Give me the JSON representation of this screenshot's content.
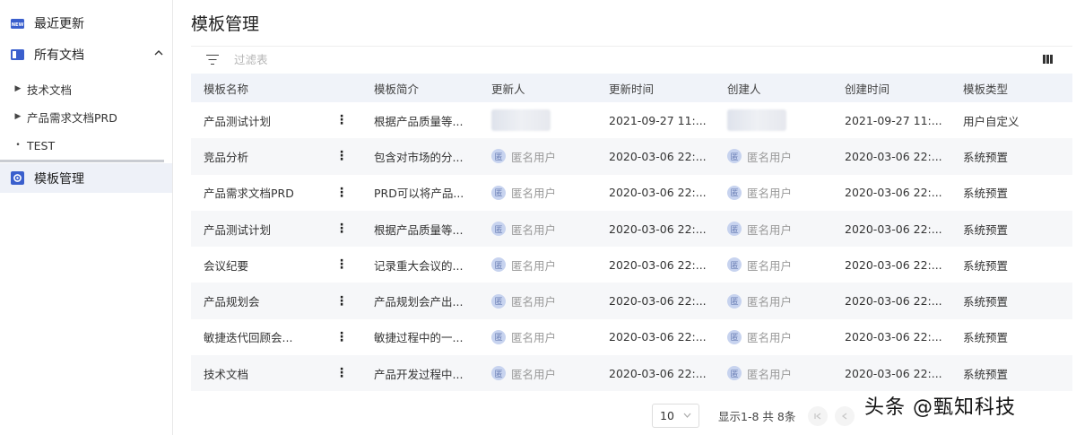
{
  "sidebar": {
    "recent": "最近更新",
    "all_docs": "所有文档",
    "sub_items": [
      "技术文档",
      "产品需求文档PRD",
      "TEST"
    ],
    "template_mgmt": "模板管理"
  },
  "main": {
    "title": "模板管理",
    "filter_placeholder": "过滤表",
    "columns": [
      "模板名称",
      "",
      "模板简介",
      "更新人",
      "更新时间",
      "创建人",
      "创建时间",
      "模板类型"
    ],
    "rows": [
      {
        "name": "产品测试计划",
        "intro": "根据产品质量等...",
        "updater": "",
        "updated": "2021-09-27 11:...",
        "creator": "",
        "created": "2021-09-27 11:...",
        "type": "用户自定义",
        "blurred": true
      },
      {
        "name": "竞品分析",
        "intro": "包含对市场的分...",
        "updater": "匿名用户",
        "updated": "2020-03-06 22:...",
        "creator": "匿名用户",
        "created": "2020-03-06 22:...",
        "type": "系统预置"
      },
      {
        "name": "产品需求文档PRD",
        "intro": "PRD可以将产品...",
        "updater": "匿名用户",
        "updated": "2020-03-06 22:...",
        "creator": "匿名用户",
        "created": "2020-03-06 22:...",
        "type": "系统预置"
      },
      {
        "name": "产品测试计划",
        "intro": "根据产品质量等...",
        "updater": "匿名用户",
        "updated": "2020-03-06 22:...",
        "creator": "匿名用户",
        "created": "2020-03-06 22:...",
        "type": "系统预置"
      },
      {
        "name": "会议纪要",
        "intro": "记录重大会议的...",
        "updater": "匿名用户",
        "updated": "2020-03-06 22:...",
        "creator": "匿名用户",
        "created": "2020-03-06 22:...",
        "type": "系统预置"
      },
      {
        "name": "产品规划会",
        "intro": "产品规划会产出...",
        "updater": "匿名用户",
        "updated": "2020-03-06 22:...",
        "creator": "匿名用户",
        "created": "2020-03-06 22:...",
        "type": "系统预置"
      },
      {
        "name": "敏捷迭代回顾会...",
        "intro": "敏捷过程中的一...",
        "updater": "匿名用户",
        "updated": "2020-03-06 22:...",
        "creator": "匿名用户",
        "created": "2020-03-06 22:...",
        "type": "系统预置"
      },
      {
        "name": "技术文档",
        "intro": "产品开发过程中...",
        "updater": "匿名用户",
        "updated": "2020-03-06 22:...",
        "creator": "匿名用户",
        "created": "2020-03-06 22:...",
        "type": "系统预置"
      }
    ],
    "avatar_char": "匿",
    "row_menu_glyph": "⋮"
  },
  "pagination": {
    "page_size": "10",
    "info": "显示1-8 共 8条"
  },
  "watermark": "头条 @甄知科技",
  "icons": {
    "recent": "new-badge-icon",
    "all_docs": "book-icon",
    "template": "gear-icon"
  },
  "colors": {
    "accent": "#3a5fcd",
    "header_bg": "#f0f3f9",
    "active_nav_bg": "#eef1f8"
  }
}
